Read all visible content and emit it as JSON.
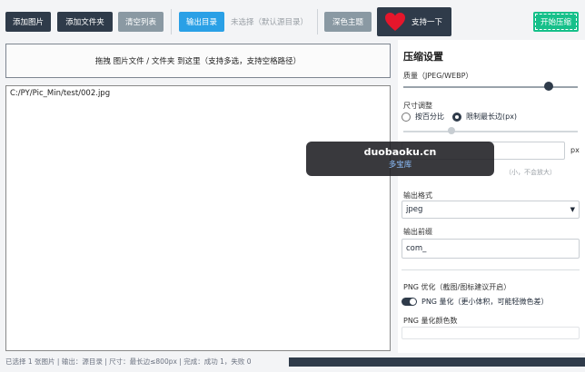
{
  "toolbar": {
    "add_image": "添加图片",
    "add_folder": "添加文件夹",
    "clear_list": "清空列表",
    "output_dir": "输出目录",
    "output_status": "未选择（默认源目录）",
    "dark_theme": "深色主题",
    "support": "支持一下",
    "start": "开始压缩"
  },
  "drop_zone": {
    "text": "拖拽 图片文件 / 文件夹 到这里（支持多选，支持空格路径）"
  },
  "file_list": {
    "items": [
      "C:/PY/Pic_Min/test/002.jpg"
    ]
  },
  "settings": {
    "title": "压缩设置",
    "quality_label": "质量（JPEG/WEBP）",
    "quality_value_fraction": 0.88,
    "size_label": "尺寸调整",
    "radio_percent": "按百分比",
    "radio_longest": "限制最长边(px)",
    "px_unit": "px",
    "hint": "（小，不会放大）",
    "format_label": "输出格式",
    "format_value": "jpeg",
    "prefix_label": "输出前缀",
    "prefix_value": "com_",
    "png_opt_label": "PNG 优化（截图/图标建议开启）",
    "png_quant_label": "PNG 量化（更小体积，可能轻微色差）",
    "png_colors_label": "PNG 量化颜色数"
  },
  "status": {
    "text": "已选择 1 张图片 | 输出：源目录 | 尺寸：最长边≤800px | 完成：成功 1，失败 0"
  },
  "watermark": {
    "line1": "duobaoku.cn",
    "line2": "多宝库"
  },
  "colors": {
    "dark": "#2f3b4a",
    "blue": "#2aa0e6",
    "gray": "#8a99a3",
    "green": "#16c08a",
    "heart": "#e5162b"
  }
}
